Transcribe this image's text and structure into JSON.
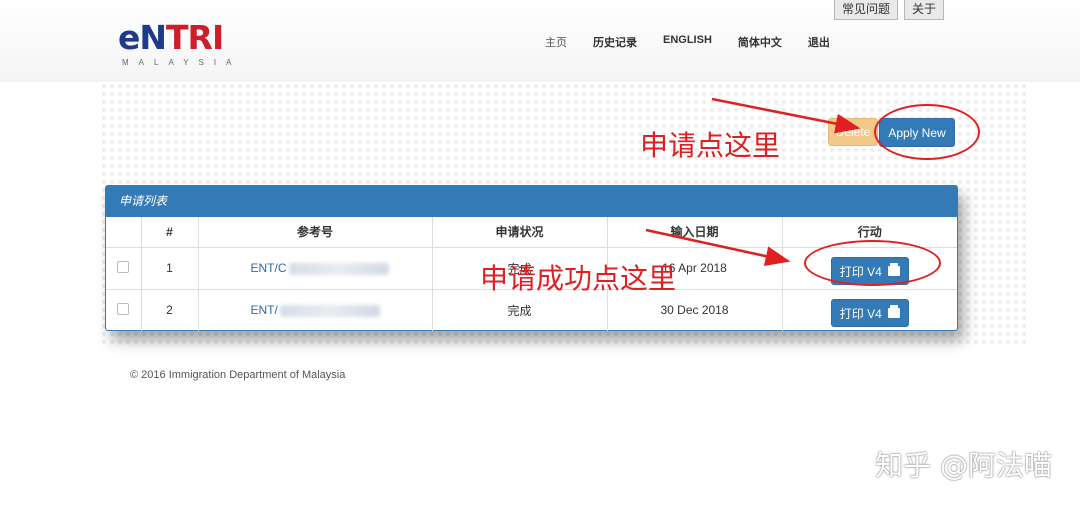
{
  "top_links": [
    "常见问题",
    "关于"
  ],
  "logo": {
    "word_e": "e",
    "word_n": "N",
    "word_t": "T",
    "word_rest": "RI",
    "subtitle": "MALAYSIA"
  },
  "nav": [
    "主页",
    "历史记录",
    "ENGLISH",
    "简体中文",
    "退出"
  ],
  "actions": {
    "delete_label": "Delete",
    "apply_label": "Apply New"
  },
  "panel": {
    "title": "申请列表",
    "headers": [
      "",
      "#",
      "参考号",
      "申请状况",
      "输入日期",
      "行动"
    ],
    "rows": [
      {
        "num": "1",
        "ref": "ENT/C",
        "status": "完成",
        "date": "16 Apr 2018",
        "action": "打印 V4"
      },
      {
        "num": "2",
        "ref": "ENT/",
        "status": "完成",
        "date": "30 Dec 2018",
        "action": "打印 V4"
      }
    ]
  },
  "footer": "© 2016 Immigration Department of Malaysia",
  "annotations": {
    "apply_hint": "申请点这里",
    "print_hint": "申请成功点这里",
    "color": "#e02020"
  },
  "watermark": "知乎 @阿法喵",
  "colors": {
    "primary": "#337ab7",
    "delete": "#f3c989"
  },
  "icons": {
    "print": "printer-icon"
  }
}
